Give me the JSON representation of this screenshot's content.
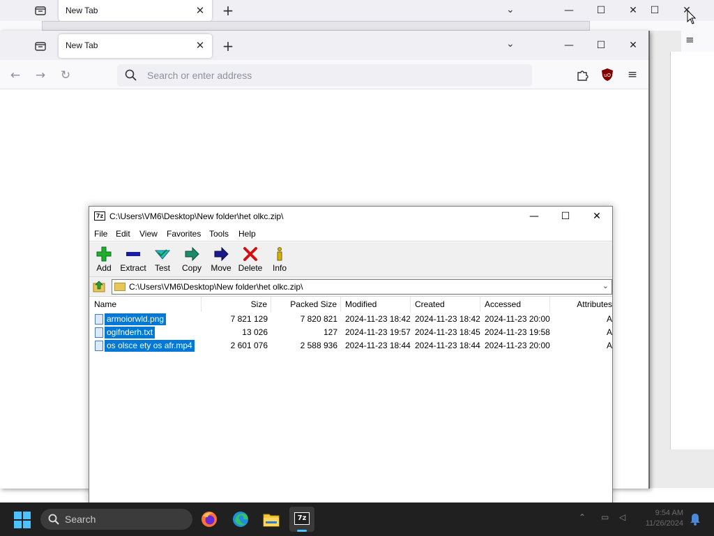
{
  "browser_back": {
    "tab_title": "New Tab",
    "window_controls": [
      "—",
      "☐",
      "✕"
    ]
  },
  "browser": {
    "tab_title": "New Tab",
    "url_placeholder": "Search or enter address",
    "icons": {
      "back": "back-arrow-icon",
      "forward": "forward-arrow-icon",
      "reload": "reload-icon",
      "extensions": "puzzle-icon",
      "ublock": "ublock-icon",
      "menu": "hamburger-icon"
    }
  },
  "sevenzip": {
    "title": "C:\\Users\\VM6\\Desktop\\New folder\\het olkc.zip\\",
    "menu": [
      "File",
      "Edit",
      "View",
      "Favorites",
      "Tools",
      "Help"
    ],
    "toolbar": [
      {
        "label": "Add",
        "icon": "add-icon",
        "color": "#1fae2e"
      },
      {
        "label": "Extract",
        "icon": "extract-icon",
        "color": "#1a1aa8"
      },
      {
        "label": "Test",
        "icon": "test-icon",
        "color": "#2ab8c8"
      },
      {
        "label": "Copy",
        "icon": "copy-icon",
        "color": "#1d8a6a"
      },
      {
        "label": "Move",
        "icon": "move-icon",
        "color": "#1a1a8a"
      },
      {
        "label": "Delete",
        "icon": "delete-icon",
        "color": "#d01010"
      },
      {
        "label": "Info",
        "icon": "info-icon",
        "color": "#d8b000"
      }
    ],
    "address": "C:\\Users\\VM6\\Desktop\\New folder\\het olkc.zip\\",
    "columns": [
      "Name",
      "Size",
      "Packed Size",
      "Modified",
      "Created",
      "Accessed",
      "Attributes"
    ],
    "files": [
      {
        "name": "armoiorwld.png",
        "size": "7 821 129",
        "packed": "7 820 821",
        "modified": "2024-11-23 18:42",
        "created": "2024-11-23 18:42",
        "accessed": "2024-11-23 20:00",
        "attr": "A"
      },
      {
        "name": "ogifnderh.txt",
        "size": "13 026",
        "packed": "127",
        "modified": "2024-11-23 19:57",
        "created": "2024-11-23 18:45",
        "accessed": "2024-11-23 19:58",
        "attr": "A"
      },
      {
        "name": "os olsce ety os afr.mp4",
        "size": "2 601 076",
        "packed": "2 588 936",
        "modified": "2024-11-23 18:44",
        "created": "2024-11-23 18:44",
        "accessed": "2024-11-23 20:00",
        "attr": "A"
      }
    ]
  },
  "taskbar": {
    "search_label": "Search",
    "apps": [
      "firefox-icon",
      "edge-icon",
      "file-explorer-icon",
      "7zip-icon"
    ],
    "clock_time": "9:54 AM",
    "clock_date": "11/26/2024"
  }
}
